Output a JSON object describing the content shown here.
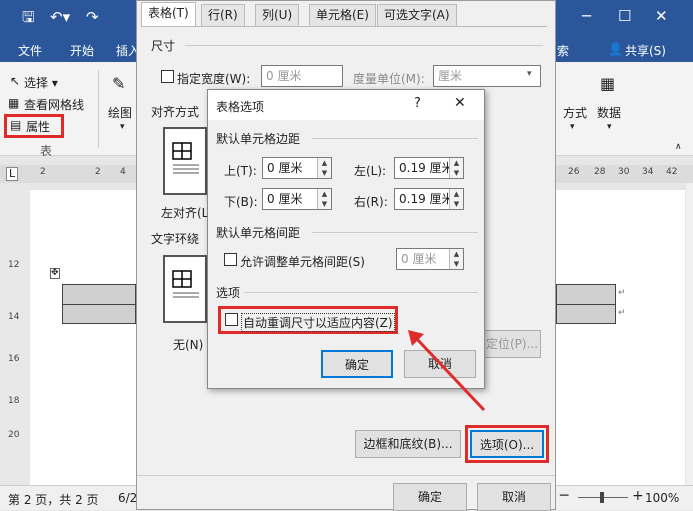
{
  "word": {
    "ribbon_tabs": {
      "file": "文件",
      "home": "开始",
      "insert": "插入",
      "search": "索",
      "share": "共享(S)"
    },
    "ribbon": {
      "select": "选择 ▾",
      "gridlines": "查看网格线",
      "properties": "属性",
      "group_table": "表",
      "draw": "绘图",
      "direction": "方式",
      "data": "数据"
    },
    "ruler_left": [
      "2",
      "2",
      "4"
    ],
    "ruler_right": [
      "26",
      "28",
      "30",
      "32",
      "34",
      "36",
      "38",
      "40",
      "42"
    ],
    "vruler": [
      "12",
      "14",
      "16",
      "18",
      "20"
    ],
    "status": {
      "page": "第 2 页，共 2 页",
      "words": "6/2",
      "zoom": "100%"
    }
  },
  "table_properties": {
    "tabs": [
      "表格(T)",
      "行(R)",
      "列(U)",
      "单元格(E)",
      "可选文字(A)"
    ],
    "size_group": "尺寸",
    "preferred_width_label": "指定宽度(W):",
    "preferred_width_value": "0 厘米",
    "measure_label": "度量单位(M):",
    "measure_value": "厘米",
    "alignment_group": "对齐方式",
    "align_left": "左对齐(L)",
    "wrap_group": "文字环绕",
    "wrap_none": "无(N)",
    "position_button": "定位(P)...",
    "borders_button": "边框和底纹(B)...",
    "options_button": "选项(O)...",
    "ok_button": "确定",
    "cancel_button": "取消"
  },
  "cell_options": {
    "title": "表格选项",
    "help": "?",
    "close": "✕",
    "margins_group": "默认单元格边距",
    "top_label": "上(T):",
    "top_value": "0 厘米",
    "left_label": "左(L):",
    "left_value": "0.19 厘米",
    "bottom_label": "下(B):",
    "bottom_value": "0 厘米",
    "right_label": "右(R):",
    "right_value": "0.19 厘米",
    "spacing_group": "默认单元格间距",
    "allow_spacing_label": "允许调整单元格间距(S)",
    "spacing_value": "0 厘米",
    "options_group": "选项",
    "autoresize_label": "自动重调尺寸以适应内容(Z)",
    "ok_button": "确定",
    "cancel_button": "取消"
  },
  "colors": {
    "word_blue": "#2b579a",
    "highlight_red": "#e02b2b",
    "focus_blue": "#0078d7"
  }
}
